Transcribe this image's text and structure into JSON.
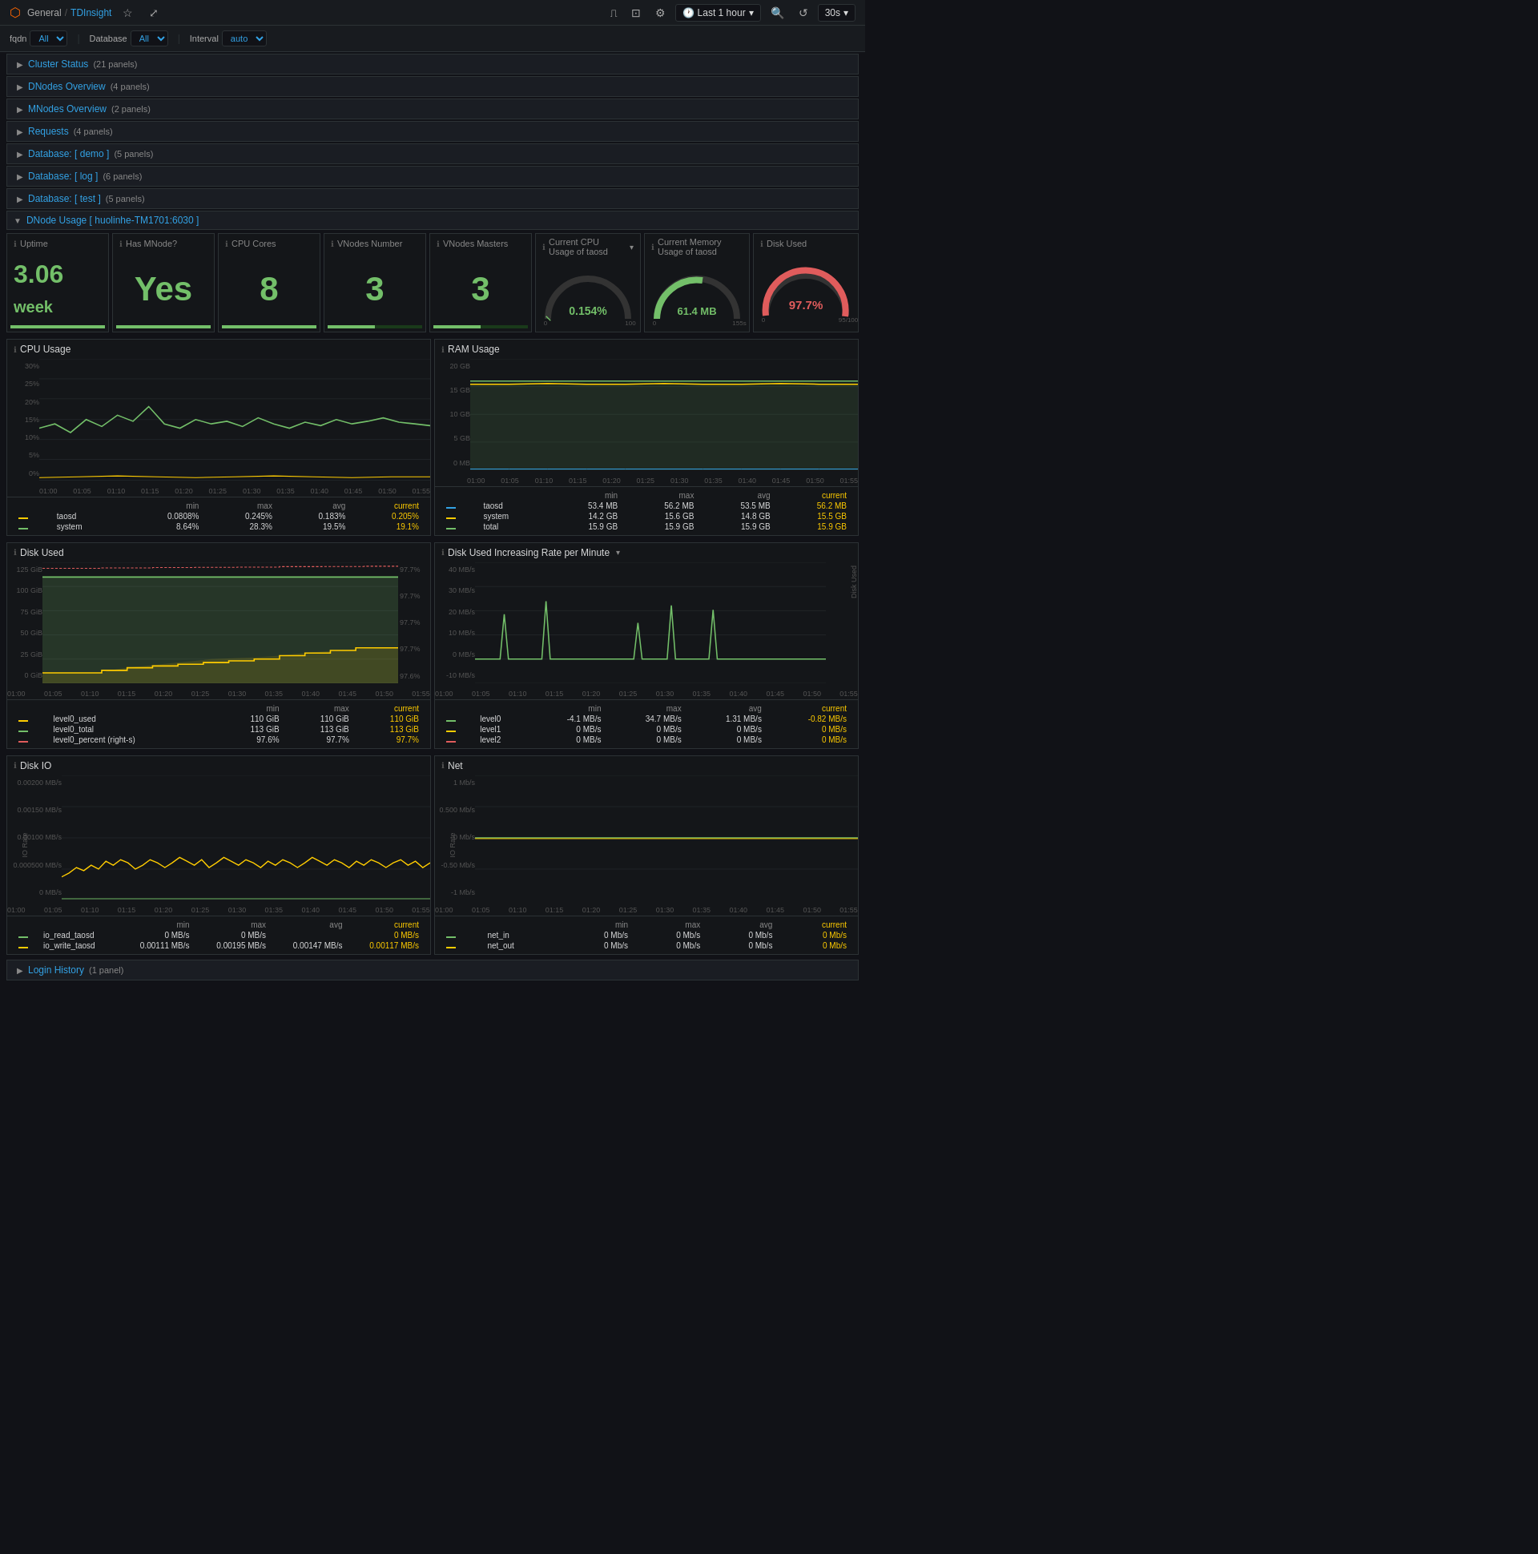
{
  "topbar": {
    "home_icon": "⌂",
    "breadcrumb_general": "General",
    "breadcrumb_sep": "/",
    "breadcrumb_current": "TDInsight",
    "star_icon": "☆",
    "share_icon": "⤢",
    "chart_icon": "⎍",
    "camera_icon": "⊡",
    "gear_icon": "⚙",
    "time_range": "Last 1 hour",
    "refresh_icon": "↺",
    "interval": "30s"
  },
  "toolbar": {
    "fqdn_label": "fqdn",
    "all_label": "All",
    "database_label": "Database",
    "db_all": "All",
    "interval_label": "Interval",
    "auto_label": "auto"
  },
  "sections": [
    {
      "id": "cluster-status",
      "label": "Cluster Status",
      "count": "21 panels",
      "expanded": false
    },
    {
      "id": "dnodes-overview",
      "label": "DNodes Overview",
      "count": "4 panels",
      "expanded": false
    },
    {
      "id": "mnodes-overview",
      "label": "MNodes Overview",
      "count": "2 panels",
      "expanded": false
    },
    {
      "id": "requests",
      "label": "Requests",
      "count": "4 panels",
      "expanded": false
    },
    {
      "id": "database-demo",
      "label": "Database: [ demo ]",
      "count": "5 panels",
      "expanded": false
    },
    {
      "id": "database-log",
      "label": "Database: [ log ]",
      "count": "6 panels",
      "expanded": false
    },
    {
      "id": "database-test",
      "label": "Database: [ test ]",
      "count": "5 panels",
      "expanded": false
    }
  ],
  "dnode_section": {
    "title": "DNode Usage [ huolinhe-TM1701:6030 ]",
    "panels": {
      "uptime": {
        "title": "Uptime",
        "value": "3.06",
        "unit": "week"
      },
      "has_mnode": {
        "title": "Has MNode?",
        "value": "Yes"
      },
      "cpu_cores": {
        "title": "CPU Cores",
        "value": "8"
      },
      "vnodes_number": {
        "title": "VNodes Number",
        "value": "3"
      },
      "vnodes_masters": {
        "title": "VNodes Masters",
        "value": "3"
      }
    },
    "gauges": {
      "cpu_usage": {
        "title": "Current CPU Usage of taosd",
        "value": "0.154%",
        "pct": 0.15
      },
      "memory_usage": {
        "title": "Current Memory Usage of taosd",
        "value": "61.4 MB",
        "pct": 40
      },
      "disk_used": {
        "title": "Disk Used",
        "value": "97.7%",
        "pct": 97.7,
        "color_high": true
      }
    }
  },
  "cpu_chart": {
    "title": "CPU Usage",
    "y_labels": [
      "30%",
      "25%",
      "20%",
      "15%",
      "10%",
      "5%",
      "0%"
    ],
    "x_labels": [
      "01:00",
      "01:05",
      "01:10",
      "01:15",
      "01:20",
      "01:25",
      "01:30",
      "01:35",
      "01:40",
      "01:45",
      "01:50",
      "01:55"
    ],
    "series": [
      {
        "name": "taosd",
        "color": "#ffcc00",
        "min": "0.0808%",
        "max": "0.245%",
        "avg": "0.183%",
        "current": "0.205%"
      },
      {
        "name": "system",
        "color": "#73bf69",
        "min": "8.64%",
        "max": "28.3%",
        "avg": "19.5%",
        "current": "19.1%"
      }
    ]
  },
  "ram_chart": {
    "title": "RAM Usage",
    "y_labels": [
      "20 GB",
      "15 GB",
      "10 GB",
      "5 GB",
      "0 MB"
    ],
    "x_labels": [
      "01:00",
      "01:05",
      "01:10",
      "01:15",
      "01:20",
      "01:25",
      "01:30",
      "01:35",
      "01:40",
      "01:45",
      "01:50",
      "01:55"
    ],
    "series": [
      {
        "name": "taosd",
        "color": "#33a2e5",
        "min": "53.4 MB",
        "max": "56.2 MB",
        "avg": "53.5 MB",
        "current": "56.2 MB"
      },
      {
        "name": "system",
        "color": "#ffcc00",
        "min": "14.2 GB",
        "max": "15.6 GB",
        "avg": "14.8 GB",
        "current": "15.5 GB"
      },
      {
        "name": "total",
        "color": "#73bf69",
        "min": "15.9 GB",
        "max": "15.9 GB",
        "avg": "15.9 GB",
        "current": "15.9 GB"
      }
    ]
  },
  "disk_used_chart": {
    "title": "Disk Used",
    "y_labels": [
      "125 GiB",
      "100 GiB",
      "75 GiB",
      "50 GiB",
      "25 GiB",
      "0 GiB"
    ],
    "y_right_labels": [
      "97.7%",
      "97.7%",
      "97.7%",
      "97.7%",
      "97.6%"
    ],
    "x_labels": [
      "01:00",
      "01:05",
      "01:10",
      "01:15",
      "01:20",
      "01:25",
      "01:30",
      "01:35",
      "01:40",
      "01:45",
      "01:50",
      "01:55"
    ],
    "series": [
      {
        "name": "level0_used",
        "color": "#ffcc00",
        "min": "110 GiB",
        "max": "110 GiB",
        "current": "110 GiB"
      },
      {
        "name": "level0_total",
        "color": "#73bf69",
        "min": "113 GiB",
        "max": "113 GiB",
        "current": "113 GiB"
      },
      {
        "name": "level0_percent (right-s)",
        "color": "#e05c5c",
        "min": "97.6%",
        "max": "97.7%",
        "current": "97.7%"
      }
    ]
  },
  "disk_rate_chart": {
    "title": "Disk Used Increasing Rate per Minute",
    "y_labels": [
      "40 MB/s",
      "30 MB/s",
      "20 MB/s",
      "10 MB/s",
      "0 MB/s",
      "-10 MB/s"
    ],
    "x_labels": [
      "01:00",
      "01:05",
      "01:10",
      "01:15",
      "01:20",
      "01:25",
      "01:30",
      "01:35",
      "01:40",
      "01:45",
      "01:50",
      "01:55"
    ],
    "series": [
      {
        "name": "level0",
        "color": "#73bf69",
        "min": "-4.1 MB/s",
        "max": "34.7 MB/s",
        "avg": "1.31 MB/s",
        "current": "-0.82 MB/s"
      },
      {
        "name": "level1",
        "color": "#ffcc00",
        "min": "0 MB/s",
        "max": "0 MB/s",
        "avg": "0 MB/s",
        "current": "0 MB/s"
      },
      {
        "name": "level2",
        "color": "#e05c5c",
        "min": "0 MB/s",
        "max": "0 MB/s",
        "avg": "0 MB/s",
        "current": "0 MB/s"
      }
    ]
  },
  "disk_io_chart": {
    "title": "Disk IO",
    "y_labels": [
      "0.00200 MB/s",
      "0.00150 MB/s",
      "0.00100 MB/s",
      "0.000500 MB/s",
      "0 MB/s"
    ],
    "x_labels": [
      "01:00",
      "01:05",
      "01:10",
      "01:15",
      "01:20",
      "01:25",
      "01:30",
      "01:35",
      "01:40",
      "01:45",
      "01:50",
      "01:55"
    ],
    "y_axis_label": "IO Rate",
    "series": [
      {
        "name": "io_read_taosd",
        "color": "#73bf69",
        "min": "0 MB/s",
        "max": "0 MB/s",
        "avg": "",
        "current": "0 MB/s"
      },
      {
        "name": "io_write_taosd",
        "color": "#ffcc00",
        "min": "0.00111 MB/s",
        "max": "0.00195 MB/s",
        "avg": "0.00147 MB/s",
        "current": "0.00117 MB/s"
      }
    ]
  },
  "net_chart": {
    "title": "Net",
    "y_labels": [
      "1 Mb/s",
      "0.500 Mb/s",
      "0 Mb/s",
      "-0.50 Mb/s",
      "-1 Mb/s"
    ],
    "x_labels": [
      "01:00",
      "01:05",
      "01:10",
      "01:15",
      "01:20",
      "01:25",
      "01:30",
      "01:35",
      "01:40",
      "01:45",
      "01:50",
      "01:55"
    ],
    "y_axis_label": "IO Rate",
    "series": [
      {
        "name": "net_in",
        "color": "#73bf69",
        "min": "0 Mb/s",
        "max": "0 Mb/s",
        "avg": "0 Mb/s",
        "current": "0 Mb/s"
      },
      {
        "name": "net_out",
        "color": "#ffcc00",
        "min": "0 Mb/s",
        "max": "0 Mb/s",
        "avg": "0 Mb/s",
        "current": "0 Mb/s"
      }
    ]
  },
  "login_history": {
    "title": "Login History",
    "count": "1 panel"
  },
  "legend_headers": {
    "min": "min",
    "max": "max",
    "avg": "avg",
    "current": "current"
  }
}
